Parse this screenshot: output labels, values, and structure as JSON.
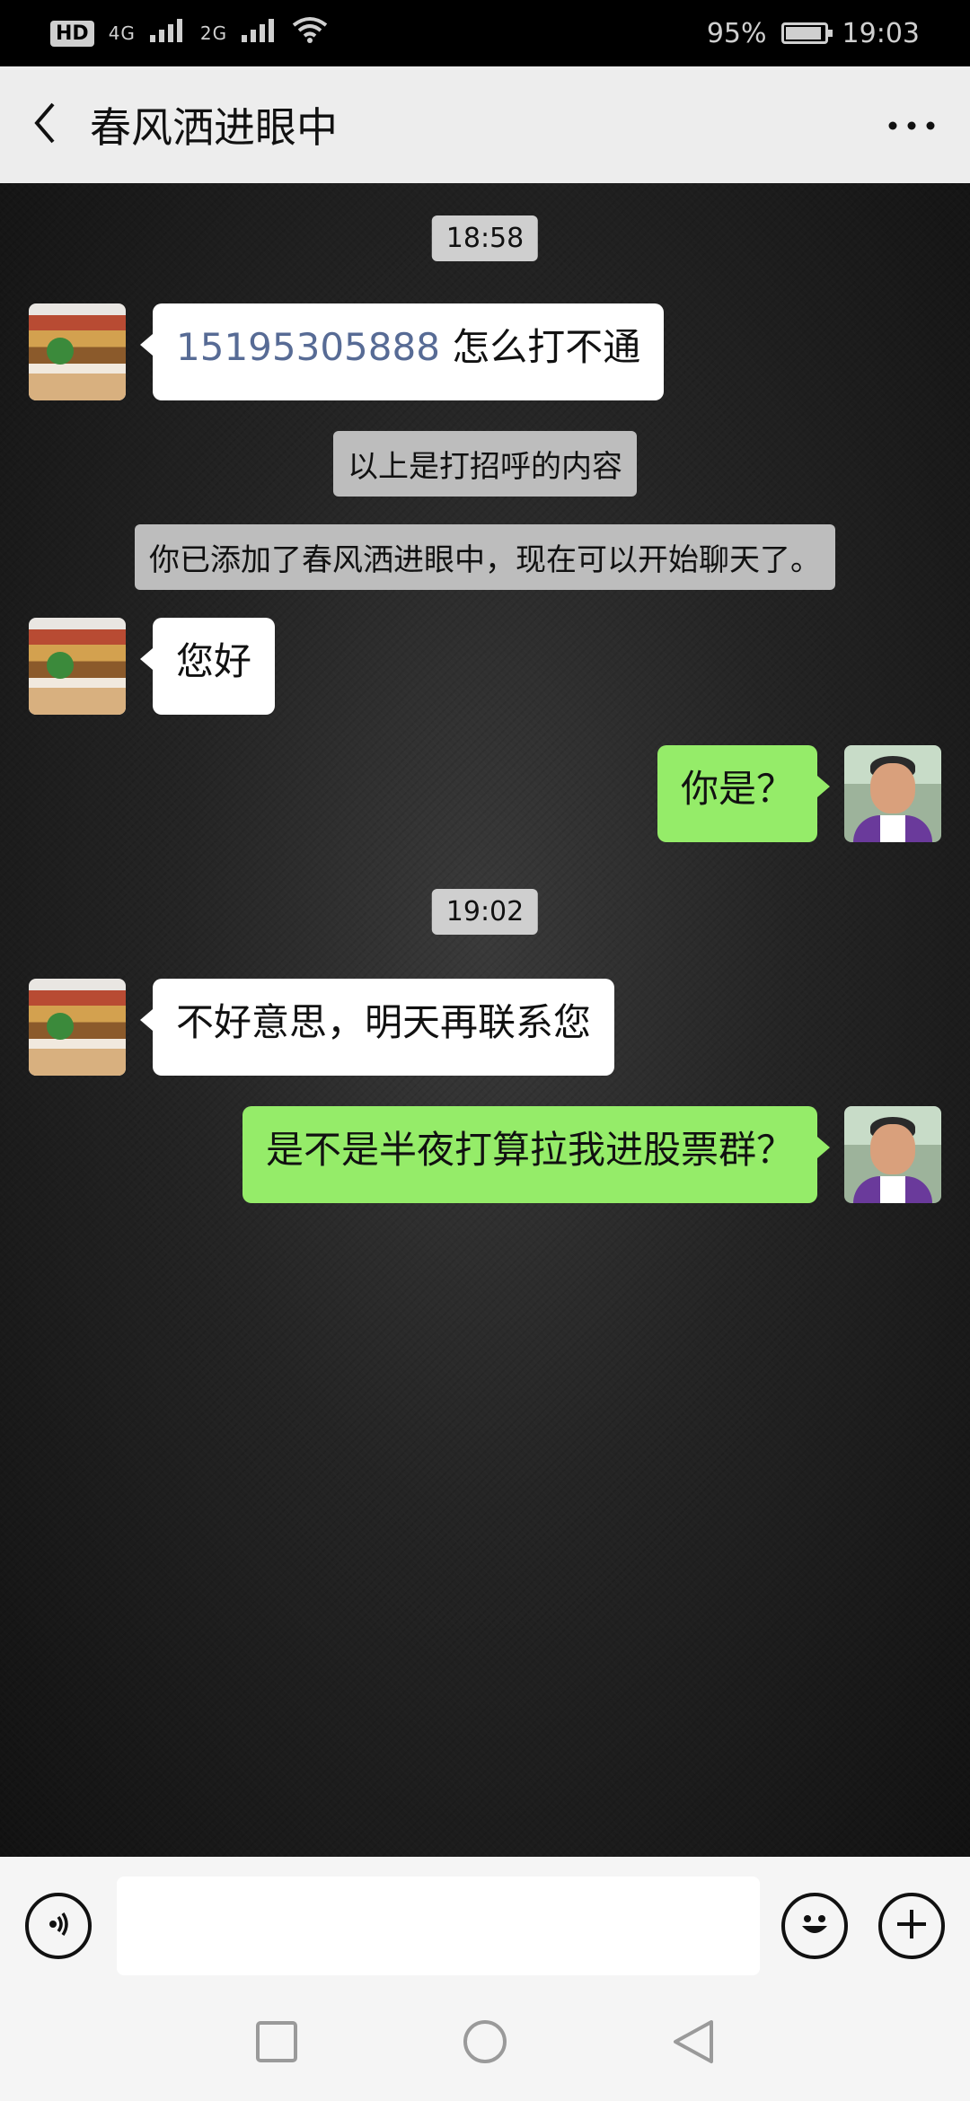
{
  "status_bar": {
    "hd": "HD",
    "sim1_label": "4G",
    "sim2_label": "2G",
    "battery_percent": "95%",
    "battery_level": 0.95,
    "time": "19:03"
  },
  "header": {
    "title": "春风洒进眼中",
    "back_icon": "chevron-left-icon",
    "more_icon": "more-horizontal-icon"
  },
  "messages": [
    {
      "type": "time",
      "text": "18:58"
    },
    {
      "type": "incoming",
      "link": "15195305888",
      "text": " 怎么打不通"
    },
    {
      "type": "system",
      "text": "以上是打招呼的内容"
    },
    {
      "type": "system",
      "text": "你已添加了春风洒进眼中，现在可以开始聊天了。"
    },
    {
      "type": "incoming",
      "text": "您好"
    },
    {
      "type": "outgoing",
      "text": "你是？"
    },
    {
      "type": "time",
      "text": "19:02"
    },
    {
      "type": "incoming",
      "text": "不好意思，明天再联系您"
    },
    {
      "type": "outgoing",
      "text": "是不是半夜打算拉我进股票群？"
    }
  ],
  "input_bar": {
    "voice_icon": "voice-icon",
    "emoji_icon": "emoji-icon",
    "plus_icon": "plus-icon",
    "text_value": ""
  },
  "nav_bar": {
    "recent_icon": "square-icon",
    "home_icon": "circle-icon",
    "back_icon": "triangle-back-icon"
  },
  "colors": {
    "outgoing_bubble": "#95ec69",
    "incoming_bubble": "#ffffff",
    "link": "#576b95",
    "header_bg": "#ededed"
  }
}
